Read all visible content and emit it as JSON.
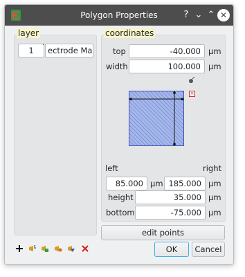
{
  "window": {
    "title": "Polygon Properties",
    "help_glyph": "?",
    "minimize_glyph": "⌄",
    "maximize_glyph": "⌃",
    "close_glyph": "✕"
  },
  "layer": {
    "title": "layer",
    "number": "1",
    "name": "ectrode Mask"
  },
  "coordinates": {
    "title": "coordinates",
    "top_label": "top",
    "top_value": "-40.000",
    "width_label": "width",
    "width_value": "100.000",
    "left_label": "left",
    "left_value": "85.000",
    "right_label": "right",
    "right_value": "185.000",
    "height_label": "height",
    "height_value": "35.000",
    "bottom_label": "bottom",
    "bottom_value": "-75.000",
    "unit": "µm"
  },
  "buttons": {
    "edit_points": "edit points",
    "ok": "OK",
    "cancel": "Cancel"
  },
  "toolbar_icons": [
    "add-icon",
    "layer-tool-icon",
    "layer-tool-green-icon",
    "layer-tool-orange-icon",
    "layer-tool-blue-icon",
    "delete-icon"
  ],
  "colors": {
    "titlebar": "#4d4d4d",
    "group_title_highlight": "#f6f3c8",
    "preview_fill": "#a5b8e8",
    "preview_border": "#4050b8"
  }
}
